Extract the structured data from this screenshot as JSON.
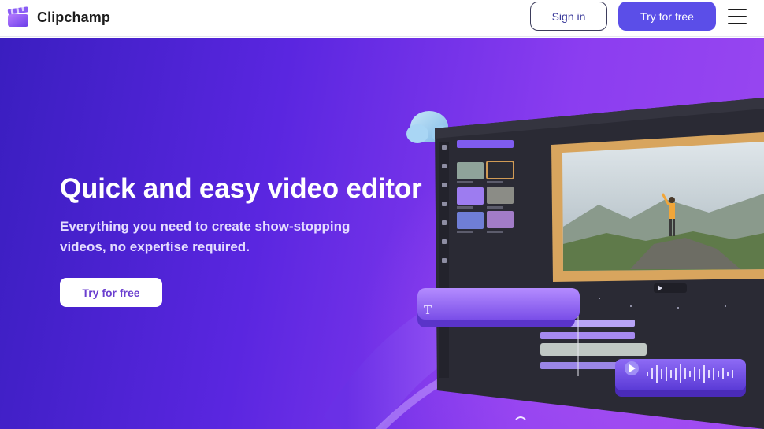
{
  "header": {
    "brand": "Clipchamp",
    "signin_label": "Sign in",
    "try_label": "Try for free"
  },
  "hero": {
    "title": "Quick and easy video editor",
    "subtitle": "Everything you need to create show-stopping videos, no expertise required.",
    "cta_label": "Try for free"
  },
  "icons": {
    "logo": "clipchamp-logo-icon",
    "menu": "hamburger-menu-icon",
    "text_tool": "T",
    "play": "play-icon"
  },
  "colors": {
    "brand_accent": "#5b4ee8",
    "hero_start": "#3a1ec0",
    "hero_end": "#9a48f0"
  }
}
